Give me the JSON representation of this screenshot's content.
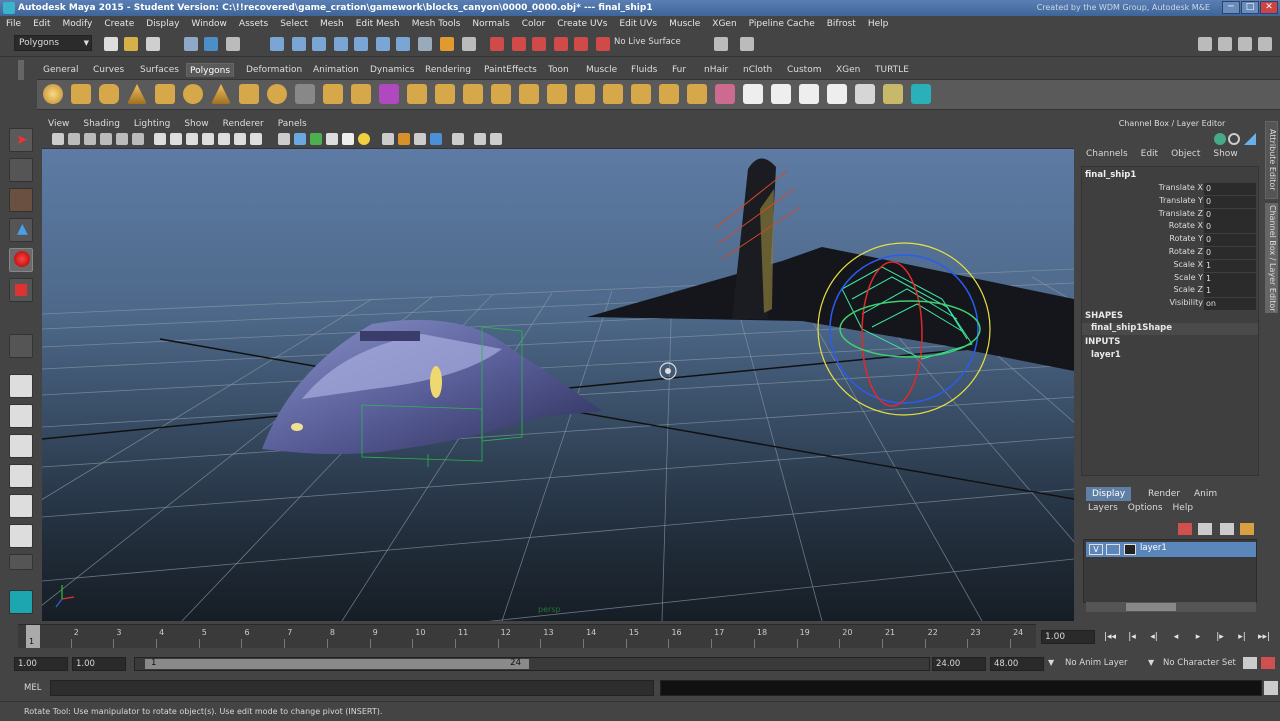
{
  "window": {
    "title": "Autodesk Maya 2015 - Student Version: C:\\!!recovered\\game_cration\\gamework\\blocks_canyon\\0000_0000.obj*  ---  final_ship1",
    "credit": "Created by the WDM Group, Autodesk M&E",
    "min_glyph": "─",
    "max_glyph": "□",
    "close_glyph": "✕"
  },
  "menubar": [
    "File",
    "Edit",
    "Modify",
    "Create",
    "Display",
    "Window",
    "Assets",
    "Select",
    "Mesh",
    "Edit Mesh",
    "Mesh Tools",
    "Normals",
    "Color",
    "Create UVs",
    "Edit UVs",
    "Muscle",
    "XGen",
    "Pipeline Cache",
    "Bifrost",
    "Help"
  ],
  "statusline": {
    "mode": "Polygons",
    "live_surface": "No Live Surface"
  },
  "shelf_tabs": [
    "General",
    "Curves",
    "Surfaces",
    "Polygons",
    "Deformation",
    "Animation",
    "Dynamics",
    "Rendering",
    "PaintEffects",
    "Toon",
    "Muscle",
    "Fluids",
    "Fur",
    "nHair",
    "nCloth",
    "Custom",
    "XGen",
    "TURTLE"
  ],
  "shelf_active": "Polygons",
  "viewport": {
    "menu": [
      "View",
      "Shading",
      "Lighting",
      "Show",
      "Renderer",
      "Panels"
    ],
    "axis_label": "persp"
  },
  "channel_box": {
    "header": "Channel Box / Layer Editor",
    "menu": [
      "Channels",
      "Edit",
      "Object",
      "Show"
    ],
    "object": "final_ship1",
    "attributes": [
      {
        "label": "Translate X",
        "value": "0"
      },
      {
        "label": "Translate Y",
        "value": "0"
      },
      {
        "label": "Translate Z",
        "value": "0"
      },
      {
        "label": "Rotate X",
        "value": "0"
      },
      {
        "label": "Rotate Y",
        "value": "0"
      },
      {
        "label": "Rotate Z",
        "value": "0"
      },
      {
        "label": "Scale X",
        "value": "1"
      },
      {
        "label": "Scale Y",
        "value": "1"
      },
      {
        "label": "Scale Z",
        "value": "1"
      },
      {
        "label": "Visibility",
        "value": "on"
      }
    ],
    "shapes_heading": "SHAPES",
    "shape_name": "final_ship1Shape",
    "inputs_heading": "INPUTS",
    "input_name": "layer1"
  },
  "side_tabs": [
    "Attribute Editor",
    "Channel Box / Layer Editor"
  ],
  "layer_editor": {
    "tabs": [
      "Display",
      "Render",
      "Anim"
    ],
    "active_tab": "Display",
    "menu": [
      "Layers",
      "Options",
      "Help"
    ],
    "layer_v": "V",
    "layer_name": "layer1"
  },
  "timeline": {
    "ticks": [
      "1",
      "2",
      "3",
      "4",
      "5",
      "6",
      "7",
      "8",
      "9",
      "10",
      "11",
      "12",
      "13",
      "14",
      "15",
      "16",
      "17",
      "18",
      "19",
      "20",
      "21",
      "22",
      "23",
      "24"
    ],
    "current_frame": "1",
    "current_time": "1.00",
    "play_glyphs": [
      "|◂◂",
      "|◂",
      "◂|",
      "◂",
      "▸",
      "|▸",
      "▸|",
      "▸▸|",
      "⟲"
    ]
  },
  "range": {
    "start": "1.00",
    "inner_start": "1.00",
    "slider_start": "1",
    "slider_end": "24",
    "end": "24.00",
    "total_end": "48.00",
    "anim_layer": "No Anim Layer",
    "character_set": "No Character Set"
  },
  "command": {
    "label": "MEL"
  },
  "help_line": "Rotate Tool: Use manipulator to rotate object(s). Use edit mode to change pivot (INSERT)."
}
